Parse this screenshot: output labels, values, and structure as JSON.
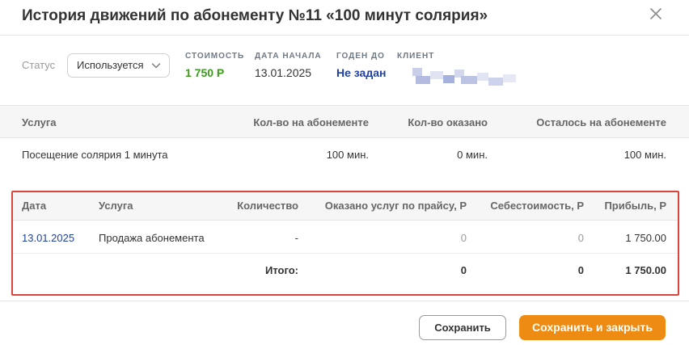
{
  "dialog": {
    "title": "История движений по абонементу №11 «100 минут солярия»",
    "close_icon": "close-icon"
  },
  "info": {
    "status_label": "Статус",
    "status_value": "Используется",
    "cost_label": "СТОИМОСТЬ",
    "cost_value": "1 750 Р",
    "start_label": "ДАТА НАЧАЛА",
    "start_value": "13.01.2025",
    "valid_label": "ГОДЕН ДО",
    "valid_value": "Не задан",
    "client_label": "КЛИЕНТ"
  },
  "services_table": {
    "headers": [
      "Услуга",
      "Кол-во на абонементе",
      "Кол-во оказано",
      "Осталось на абонементе"
    ],
    "rows": [
      [
        "Посещение солярия 1 минута",
        "100 мин.",
        "0 мин.",
        "100 мин."
      ]
    ]
  },
  "movements_table": {
    "headers": [
      "Дата",
      "Услуга",
      "Количество",
      "Оказано услуг по прайсу, Р",
      "Себестоимость, Р",
      "Прибыль, Р"
    ],
    "rows": [
      [
        "13.01.2025",
        "Продажа абонемента",
        "-",
        "0",
        "0",
        "1 750.00"
      ]
    ],
    "total": {
      "label": "Итого:",
      "price_sum": "0",
      "cost_sum": "0",
      "profit_sum": "1 750.00"
    }
  },
  "footer": {
    "save_label": "Сохранить",
    "save_close_label": "Сохранить и закрыть"
  },
  "colors": {
    "accent_orange": "#ee8b12",
    "highlight_red": "#d9443b",
    "link_blue": "#22419e",
    "price_green": "#3a9a19"
  }
}
